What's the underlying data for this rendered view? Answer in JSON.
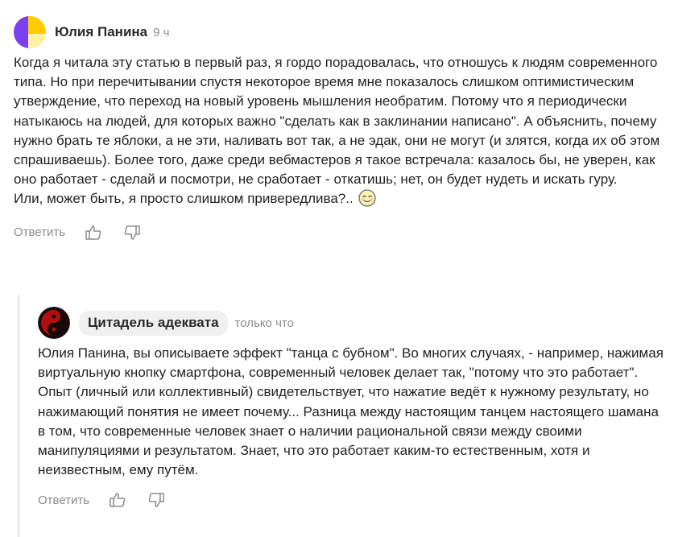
{
  "comment1": {
    "author": "Юлия Панина",
    "time": "9 ч",
    "paragraphs": [
      "Когда я читала эту статью в первый раз, я гордо порадовалась, что отношусь к людям современного типа. Но при перечитывании спустя некоторое время мне показалось слишком оптимистическим утверждение, что переход на новый уровень мышления необратим. Потому что я периодически натыкаюсь на людей, для которых важно \"сделать как в заклинании написано\". А объяснить, почему нужно брать те яблоки, а не эти, наливать вот так, а не эдак, они не могут (и злятся, когда их об этом спрашиваешь). Более того, даже среди вебмастеров я такое встречала: казалось бы, не уверен, как оно работает - сделай и посмотри, не сработает - откатишь; нет, он будет нудеть и искать гуру.",
      "Или, может быть, я просто слишком привередлива?.."
    ],
    "reply_label": "Ответить",
    "icons": [
      "thumbs-up-icon",
      "thumbs-down-icon",
      "blush-emoji-icon"
    ],
    "avatar_colors": [
      "#ffcc00",
      "#7b3ff2"
    ]
  },
  "comment2": {
    "author": "Цитадель адеквата",
    "time": "только что",
    "text": "Юлия Панина, вы описываете эффект \"танца с бубном\". Во многих случаях, - например, нажимая виртуальную кнопку смартфона, современный человек делает так, \"потому что это работает\". Опыт (личный или коллективный) свидетельствует, что нажатие ведёт к нужному результату, но нажимающий понятия не имеет почему... Разница между настоящим танцем настоящего шамана в том, что современные человек знает о наличии рациональной связи между своими манипуляциями и результатом. Знает, что это работает каким-то естественным, хотя и неизвестным, ему путём.",
    "reply_label": "Ответить",
    "icons": [
      "yin-yang-avatar-icon",
      "thumbs-up-icon",
      "thumbs-down-icon"
    ]
  }
}
